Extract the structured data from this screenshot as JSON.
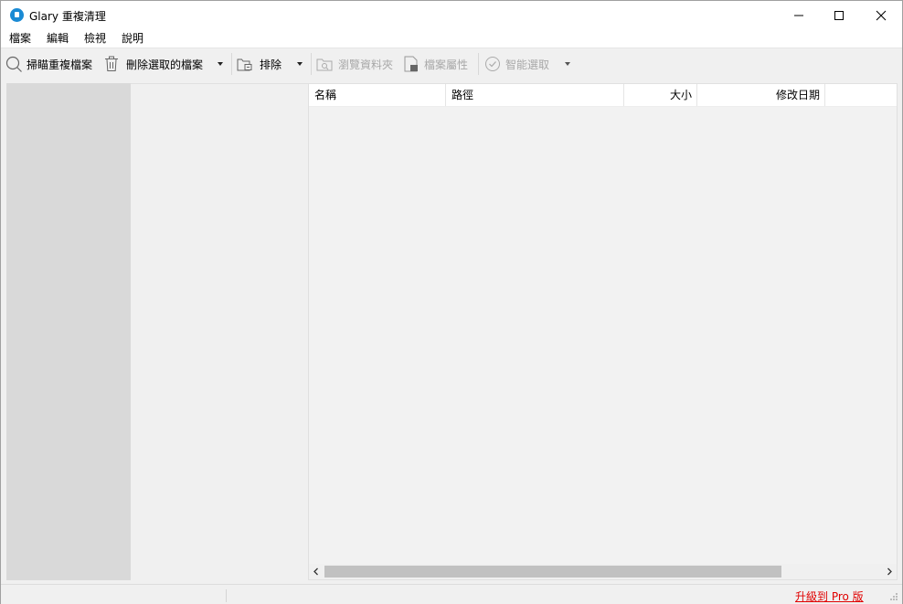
{
  "window": {
    "title": "Glary 重複清理",
    "accent_color": "#1a8ad4"
  },
  "menu": {
    "items": [
      "檔案",
      "編輯",
      "檢視",
      "說明"
    ]
  },
  "toolbar": {
    "scan_label": "掃瞄重複檔案",
    "delete_label": "刪除選取的檔案",
    "exclude_label": "排除",
    "browse_label": "瀏覽資料夾",
    "properties_label": "檔案屬性",
    "smart_select_label": "智能選取"
  },
  "grid": {
    "columns": [
      "名稱",
      "路徑",
      "大小",
      "修改日期"
    ]
  },
  "statusbar": {
    "upgrade_label": "升級到 Pro 版",
    "upgrade_color": "#e00000"
  }
}
